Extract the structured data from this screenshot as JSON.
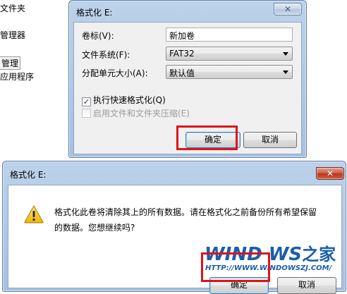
{
  "background_menu": {
    "items": [
      "文件夹",
      "管理器",
      "管理",
      "应用程序"
    ]
  },
  "format_dialog": {
    "title": "格式化 E:",
    "close_glyph": "✕",
    "volume_label": "卷标(V):",
    "volume_value": "新加卷",
    "fs_label": "文件系统(F):",
    "fs_value": "FAT32",
    "alloc_label": "分配单元大小(A):",
    "alloc_value": "默认值",
    "quick_format_label": "执行快速格式化(Q)",
    "quick_format_checked": true,
    "compress_label": "启用文件和文件夹压缩(E)",
    "compress_checked": false,
    "ok_label": "确定",
    "cancel_label": "取消"
  },
  "confirm_dialog": {
    "title": "格式化 E:",
    "close_glyph": "✕",
    "message_line1": "格式化此卷将清除其上的所有数据。请在格式化之前备份所有希望保留",
    "message_line2": "的数据。您想继续吗?",
    "ok_label": "确定",
    "cancel_label": "取消"
  },
  "watermark": {
    "logo_text": "WIND WS",
    "logo_suffix": "之家",
    "url": "HTTP://WWW.WINDOWSZJ.COM/"
  },
  "colors": {
    "highlight": "#e01218",
    "title_blue": "#a6c0de",
    "close_red": "#c75a43",
    "logo_blue": "#1a5fa8"
  },
  "icons": {
    "warning": "warning-icon",
    "checkbox_check": "checkmark-icon",
    "dropdown": "chevron-down-icon"
  }
}
